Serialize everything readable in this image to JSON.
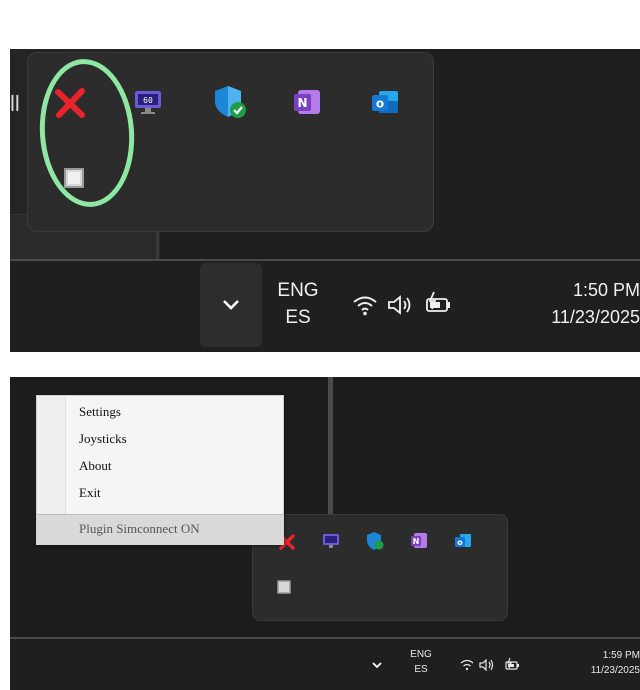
{
  "top_panel": {
    "app_partial_text": "ll",
    "tray_icons": [
      "close-x-icon",
      "display-monitor-icon",
      "shield-check-icon",
      "onenote-icon",
      "outlook-icon",
      "square-placeholder-icon"
    ],
    "taskbar": {
      "lang_primary": "ENG",
      "lang_secondary": "ES",
      "time": "1:50 PM",
      "date": "11/23/2025"
    }
  },
  "bottom_panel": {
    "context_menu": {
      "items": [
        "Settings",
        "Joysticks",
        "About",
        "Exit"
      ],
      "status": "Plugin Simconnect ON"
    },
    "tray_icons": [
      "close-x-icon",
      "display-monitor-icon",
      "shield-check-icon",
      "onenote-icon",
      "outlook-icon",
      "square-placeholder-icon"
    ],
    "taskbar": {
      "lang_primary": "ENG",
      "lang_secondary": "ES",
      "time": "1:59 PM",
      "date": "11/23/2025"
    }
  },
  "colors": {
    "annotation": "#8ee8a4",
    "close_red": "#e8242a",
    "onenote_purple": "#7b3fc2",
    "outlook_blue": "#1479d4",
    "taskbar_bg": "#1f1f1f"
  }
}
